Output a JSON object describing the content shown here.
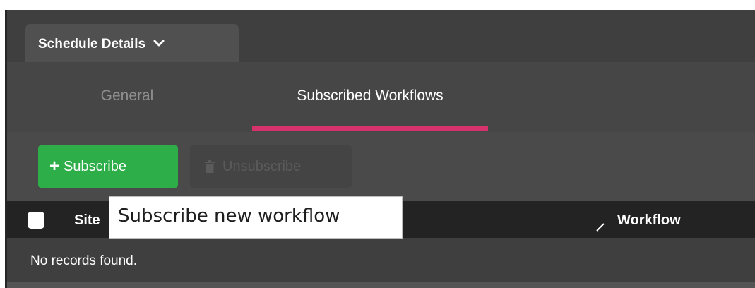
{
  "section": {
    "title": "Schedule Details"
  },
  "tabs": [
    {
      "label": "General",
      "active": false
    },
    {
      "label": "Subscribed Workflows",
      "active": true
    }
  ],
  "toolbar": {
    "subscribe_label": "Subscribe",
    "unsubscribe_label": "Unsubscribe"
  },
  "table": {
    "columns": [
      "Site",
      "Workflow"
    ],
    "empty_message": "No records found."
  },
  "tooltip": {
    "text": "Subscribe new workflow"
  },
  "colors": {
    "accent_underline": "#d6336c",
    "subscribe_button": "#2eae48",
    "header_bg": "#232323",
    "panel_bg": "#4a4a4a"
  },
  "icons": {
    "section_toggle": "chevron-down-icon",
    "subscribe": "plus-icon",
    "unsubscribe": "trash-icon",
    "column_resize": "resize-handle-icon"
  }
}
